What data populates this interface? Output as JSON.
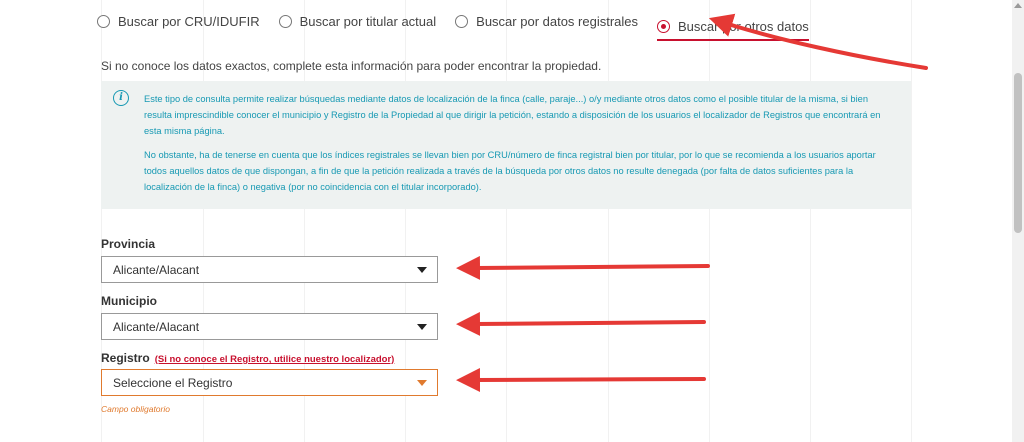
{
  "search_options": [
    {
      "label": "Buscar por CRU/IDUFIR",
      "selected": false
    },
    {
      "label": "Buscar por titular actual",
      "selected": false
    },
    {
      "label": "Buscar por datos registrales",
      "selected": false
    },
    {
      "label": "Buscar por otros datos",
      "selected": true
    }
  ],
  "intro_text": "Si no conoce los datos exactos, complete esta información para poder encontrar la propiedad.",
  "info_box": {
    "icon": "info-icon",
    "paragraph_1": "Este tipo de consulta permite realizar búsquedas mediante datos de localización de la finca (calle, paraje...) o/y mediante otros datos como el posible titular de la misma, si bien resulta imprescindible conocer el municipio y Registro de la Propiedad al que dirigir la petición, estando a disposición de los usuarios el localizador de Registros que encontrará en esta misma página.",
    "paragraph_2": "No obstante, ha de tenerse en cuenta que los índices registrales se llevan bien por CRU/número de finca registral bien por titular, por lo que se recomienda a los usuarios aportar todos aquellos datos de que dispongan, a fin de que la petición realizada a través de la búsqueda por otros datos no resulte denegada (por falta de datos suficientes para la localización de la finca) o negativa (por no coincidencia con el titular incorporado)."
  },
  "provincia": {
    "label": "Provincia",
    "value": "Alicante/Alacant"
  },
  "municipio": {
    "label": "Municipio",
    "value": "Alicante/Alacant"
  },
  "registro": {
    "label": "Registro",
    "hint": "(Si no conoce el Registro, utilice nuestro localizador)",
    "value": "Seleccione el Registro",
    "error": "Campo obligatorio"
  },
  "colors": {
    "accent": "#c8102e",
    "info": "#1799b3",
    "warning": "#e07a2e",
    "info_bg": "#eef2f1"
  }
}
